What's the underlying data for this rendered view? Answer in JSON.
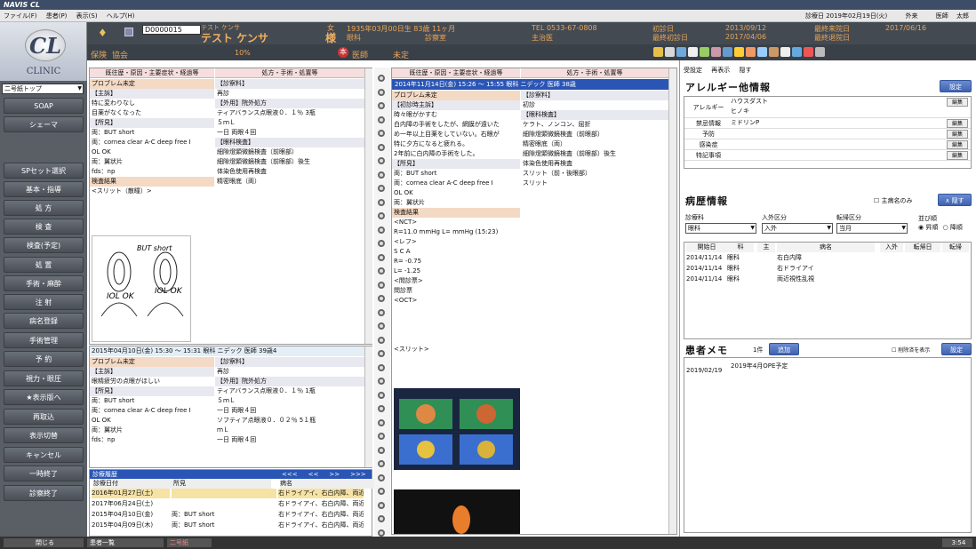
{
  "app": {
    "title": "NAVIS CL",
    "menu": [
      "ファイル(F)",
      "患者(P)",
      "表示(S)",
      "ヘルプ(H)"
    ],
    "date_label": "診療日 2019年02月19日(火)",
    "mode": "外来",
    "doctor_label": "医師",
    "doctor": "太郎"
  },
  "logo": {
    "big": "CL",
    "text": "CLINIC"
  },
  "patient": {
    "id": "D0000015",
    "kana": "テスト ケンサ",
    "name": "テスト ケンサ",
    "honor": "様",
    "sex_mark": "女",
    "birth": "1935年03月00日生 83歳 11ヶ月",
    "dept": "眼科",
    "room": "診察室",
    "tel": "TEL 0533-67-0808",
    "attending": "主治医",
    "first_label": "初診日",
    "first_date": "2013/09/12",
    "last_label": "最終初診日",
    "last_date": "2017/04/06",
    "final_visit_label": "最終来院日",
    "final_visit": "2017/06/16",
    "final_leave_label": "最終退院日",
    "insurance_label": "保険",
    "insurance": "協会",
    "rate": "10%",
    "hon_mark": "本",
    "physician_label": "医師",
    "physician": "未定"
  },
  "sidebar": {
    "combo": "二号紙トップ",
    "buttons": [
      "SOAP",
      "シェーマ",
      "SPセット選択",
      "基本・指導",
      "処 方",
      "検 査",
      "検査(予定)",
      "処 置",
      "手術・麻酔",
      "注 射",
      "病名登録",
      "手術管理",
      "予 約",
      "視力・眼圧",
      "★表示版へ",
      "再取込",
      "表示切替",
      "キャンセル",
      "一時終了",
      "診察終了"
    ]
  },
  "left_panel": {
    "col1": "既往歴・原因・主要症状・経過等",
    "col2": "処方・手術・処置等",
    "lines1": [
      "プロブレム未定",
      "【主訴】",
      "特に変わりなし",
      "目薬がなくなった",
      "【所見】",
      "両：BUT short",
      "両：cornea clear  A-C deep free  I",
      "OL OK",
      "両：翼状片",
      "fds：np",
      "検査結果",
      "<スリット（散瞳）>"
    ],
    "lines2": [
      "【診察料】",
      "再診",
      "【外用】院外処方",
      "ティアバランス点眼液０．１％  3瓶",
      "５ｍＬ",
      "一日  両眼４回",
      "【眼科検査】",
      "細隙燈顕微鏡検査（前眼部）",
      "細隙燈顕微鏡検査（前眼部）後生",
      "体染色使用再検査",
      "精密眼底（両）"
    ],
    "sketch": [
      "BUT short",
      "IOL OK",
      "IOL OK"
    ],
    "header2": "2015年04月10日(金) 15:30 ～ 15:31   眼科   ニデック 医師   39歳4",
    "lines3": [
      "プロブレム未定",
      "【主訴】",
      "眼精疲労の点眼がほしい",
      "【所見】",
      "両：BUT short",
      "両：cornea clear  A-C deep free  I",
      "OL OK",
      "両：翼状片",
      "fds：np"
    ],
    "lines4": [
      "【診察料】",
      "再診",
      "【外用】院外処方",
      "ティアバランス点眼液０．１％  1瓶",
      "５ｍＬ",
      "一日  両眼４回",
      "ソフティア点眼液０．０２％  5１瓶",
      "ｍＬ",
      "一日  両眼４回"
    ]
  },
  "history": {
    "title": "診療履歴",
    "nav": [
      "<<<",
      "<<",
      ">>",
      ">>>"
    ],
    "headers": [
      "診療日付",
      "所見",
      "病名"
    ],
    "rows": [
      [
        "2016年01月27日(土)",
        "",
        "右ドライアイ、右白内障、両近"
      ],
      [
        "2017年06月24日(土)",
        "",
        "右ドライアイ、右白内障、両近"
      ],
      [
        "2015年04月10日(金)",
        "両：BUT short",
        "右ドライアイ、右白内障、両近"
      ],
      [
        "2015年04月09日(木)",
        "両：BUT short",
        "右ドライアイ、右白内障、両近"
      ]
    ]
  },
  "mid_panel": {
    "col1": "既往歴・原因・主要症状・経過等",
    "col2": "処方・手術・処置等",
    "header": "2014年11月14日(金) 15:26 ～ 15:55   眼科   ニデック 医師   38歳",
    "lines1": [
      "プロブレム未定",
      "【初診時主訴】",
      "時々眼がかすむ",
      "白内障の手術をしたが、網膜が遠いた",
      "め一年以上目薬をしていない。右眼が",
      "特に夕方になると疲れる。",
      "2年前に白内障の手術をした。",
      "【所見】",
      "両：BUT short",
      "両：cornea clear  A-C deep free  I",
      "OL OK",
      "両：翼状片",
      "検査結果",
      "<NCT>",
      "R=11.0 mmHg  L=      mmHg  (15:23)",
      "<レフ>",
      "      S        C       A",
      "R=   -0.75",
      "L=   -1.25",
      "<問診票>",
      "問診票",
      "<OCT>",
      "",
      "",
      "",
      "",
      "<スリット>"
    ],
    "lines2": [
      "【診察料】",
      "初診",
      "【眼科検査】",
      "ケラト、ノンコン、屈折",
      "細隙燈顕微鏡検査（前眼部）",
      "精密眼底（両）",
      "細隙燈顕微鏡検査（前眼部）後生",
      "体染色使用再検査",
      "スリット（前・後眼部）",
      "スリット"
    ]
  },
  "right_panel": {
    "tools": [
      "受設定",
      "再表示",
      "隠す"
    ],
    "allergy_title": "アレルギー他情報",
    "settings_btn": "設定",
    "allergy_rows": [
      [
        "アレルギー",
        "ハウスダスト\nヒノキ"
      ],
      [
        "禁忌情報",
        "ミドリンP"
      ],
      [
        "予防",
        ""
      ],
      [
        "感染症",
        ""
      ],
      [
        "特記事項",
        ""
      ]
    ],
    "edit": "編集",
    "history_title": "病歴情報",
    "main_only": "主病名のみ",
    "hide_btn": "隠す",
    "filters": [
      {
        "label": "診療科",
        "value": "眼科"
      },
      {
        "label": "入外区分",
        "value": "入外"
      },
      {
        "label": "転帰区分",
        "value": "当月"
      }
    ],
    "sort_label": "並び順",
    "sort_opts": [
      "昇順",
      "降順"
    ],
    "disease_headers": [
      "開始日",
      "科",
      "主",
      "病名",
      "入外",
      "転帰日",
      "転帰"
    ],
    "diseases": [
      [
        "2014/11/14",
        "眼科",
        "",
        "右白内障"
      ],
      [
        "2014/11/14",
        "眼科",
        "",
        "右ドライアイ"
      ],
      [
        "2014/11/14",
        "眼科",
        "",
        "両近視性乱視"
      ]
    ],
    "memo_title": "患者メモ",
    "memo_count": "1件",
    "memo_add": "追加",
    "memo_show_deleted": "削除済を表示",
    "memo_settings": "設定",
    "memo_date": "2019/02/19",
    "memo_text": "2019年4月OPE予定"
  },
  "status": {
    "close": "閉じる",
    "tab1": "患者一覧",
    "tab2": "二号紙",
    "time": "3:54"
  },
  "colors": {
    "header_bg": "#444a52",
    "accent": "#2a55b5",
    "section": "#f4d9c4",
    "sidebar": "#5a5f66"
  }
}
